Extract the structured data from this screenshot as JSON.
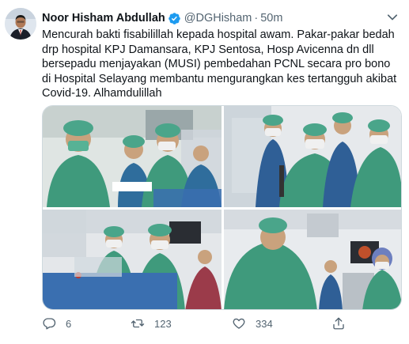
{
  "tweet": {
    "author_name": "Noor Hisham Abdullah",
    "handle": "@DGHisham",
    "separator": "·",
    "time": "50m",
    "body": "Mencurah bakti fisabilillah kepada hospital awam. Pakar-pakar bedah drp hospital KPJ Damansara, KPJ Sentosa, Hosp Avicenna dn dll bersepadu menjayakan (MUSI) pembedahan PCNL secara pro bono di Hospital Selayang membantu mengurangkan kes tertangguh akibat Covid-19. Alhamdulillah"
  },
  "actions": {
    "reply_count": "6",
    "retweet_count": "123",
    "like_count": "334"
  },
  "colors": {
    "text": "#0f1419",
    "secondary": "#536471",
    "verified": "#1d9bf0",
    "border": "#cfd9de",
    "scrubs": "#3f9a7c"
  },
  "icons": [
    "verified-badge-icon",
    "more-options-icon",
    "reply-icon",
    "retweet-icon",
    "like-icon",
    "share-icon"
  ],
  "media": {
    "photo_count": 4
  }
}
